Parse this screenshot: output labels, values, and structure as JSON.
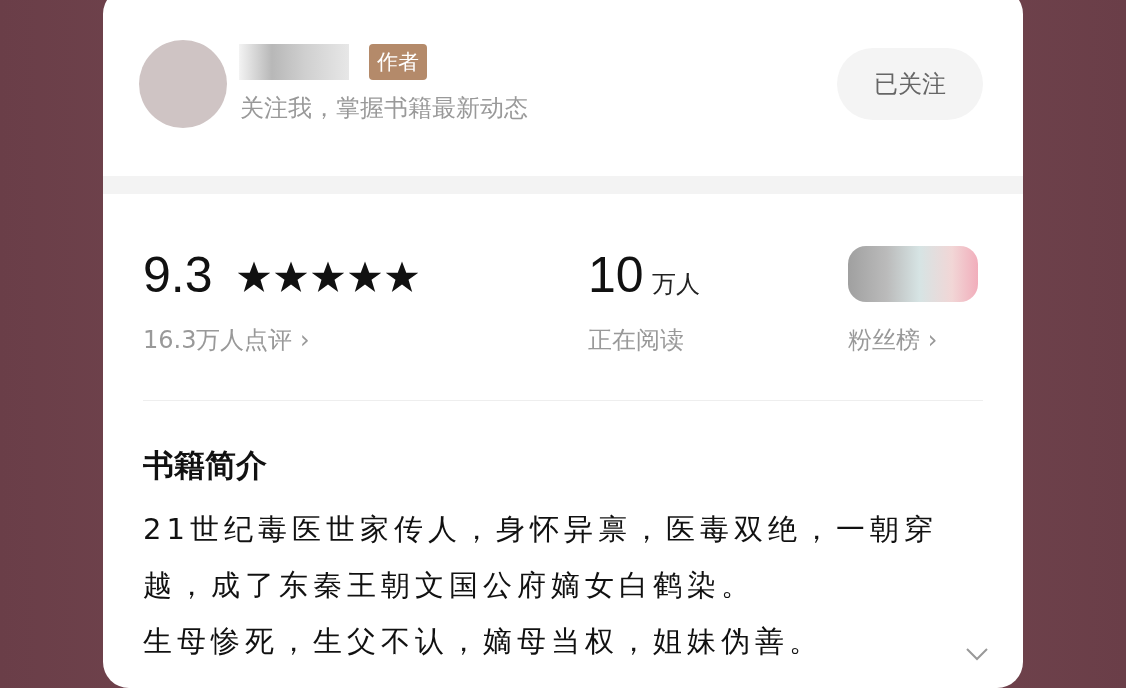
{
  "author": {
    "badge": "作者",
    "subtitle": "关注我，掌握书籍最新动态",
    "follow_button": {
      "label": "已关注",
      "followed": true
    }
  },
  "stats": {
    "rating": {
      "score": "9.3",
      "stars": 5,
      "reviews": "16.3万人点评",
      "chevron": "›"
    },
    "readers": {
      "count": "10",
      "unit": "万人",
      "label": "正在阅读"
    },
    "fans": {
      "label": "粉丝榜",
      "chevron": "›"
    }
  },
  "intro": {
    "title": "书籍简介",
    "paragraphs": [
      "21世纪毒医世家传人，身怀异禀，医毒双绝，一朝穿越，成了东秦王朝文国公府嫡女白鹤染。",
      "生母惨死，生父不认，嫡母当权，姐妹伪善。"
    ]
  }
}
